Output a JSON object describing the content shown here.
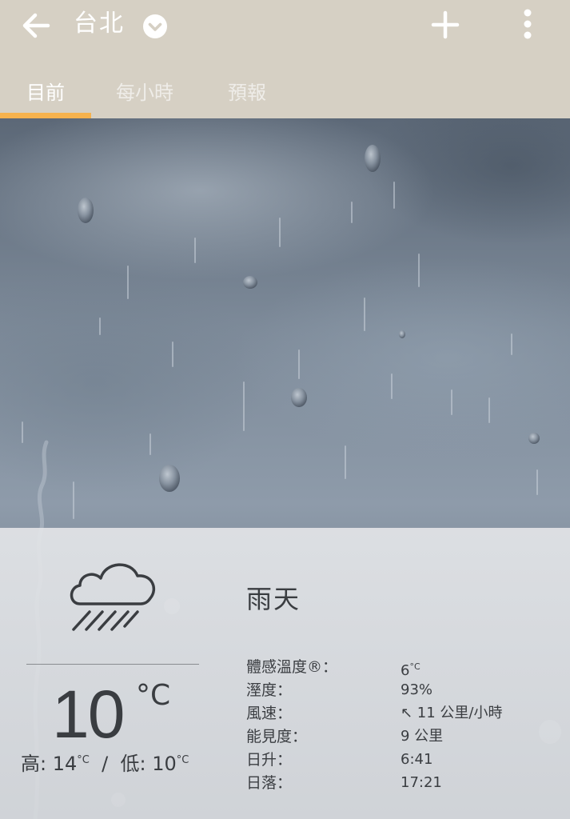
{
  "header": {
    "city": "台北"
  },
  "tabs": [
    {
      "label": "目前"
    },
    {
      "label": "每小時"
    },
    {
      "label": "預報"
    }
  ],
  "current": {
    "condition": "雨天",
    "temperature": "10",
    "temperature_unit": "°C",
    "high_label": "高:",
    "high_value": "14",
    "low_label": "低:",
    "low_value": "10",
    "degree_unit": "°C",
    "separator": "/",
    "details": [
      {
        "label": "體感溫度®：",
        "value": "6",
        "unit": "°C"
      },
      {
        "label": "溼度：",
        "value": "93%"
      },
      {
        "label": "風速：",
        "value": "↖ 11 公里/小時"
      },
      {
        "label": "能見度：",
        "value": "9 公里"
      },
      {
        "label": "日升：",
        "value": "6:41"
      },
      {
        "label": "日落：",
        "value": "17:21"
      }
    ]
  },
  "icons": {
    "back": "arrow-back-icon",
    "city_dropdown": "chevron-down-circle-icon",
    "add": "plus-icon",
    "more": "more-vert-icon",
    "weather": "rain-cloud-icon"
  },
  "colors": {
    "topbar": "#d6d0c4",
    "tab_indicator": "#f6b24d",
    "text_dark": "#3a3d41"
  }
}
